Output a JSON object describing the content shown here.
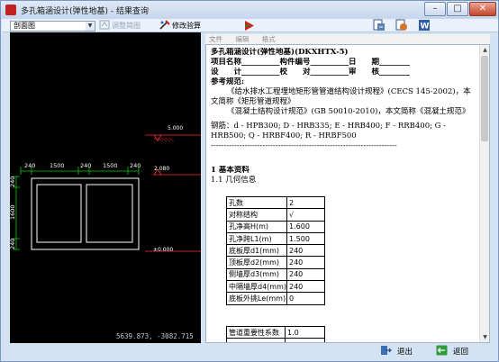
{
  "window": {
    "title": "多孔箱涵设计(弹性地基) - 结果查询",
    "minimize_label": "–",
    "maximize_label": "□",
    "close_label": "✕"
  },
  "toolbar": {
    "view_select_value": "剖面图",
    "adjust_label": "调整简图",
    "modify_label": "修改验算"
  },
  "drawing": {
    "dims_top": [
      "240",
      "1500",
      "240",
      "1500",
      "240"
    ],
    "dim_left_top": "240",
    "dim_left_middle": "1600",
    "dim_left_bottom": "240",
    "elevation_high": "5.000",
    "elevation_top": "2.080",
    "elevation_bottom": "±0.000",
    "coordinates": "5639.873, -3082.715"
  },
  "menu": {
    "items": [
      "文件",
      "编辑",
      "格式"
    ]
  },
  "document": {
    "title": "多孔箱涵设计(弹性地基)(DKXHTX-5)",
    "line_project": "项目名称__________构件编号__________日　　期________",
    "line_design": "设　　计__________校　　对__________审　　核________",
    "ref_heading": "参考规范:",
    "ref_1": "《给水排水工程埋地矩形管管道结构设计规程》(CECS 145-2002)，本文简称《矩形管道规程》",
    "ref_2": "《混凝土结构设计规范》(GB 50010-2010)，本文简称《混凝土规范》",
    "rebar": "钢筋：d - HPB300; D - HRB335; E - HRB400; F - RRB400; G - HRB500; Q - HRBF400; R - HRBF500",
    "separator": "------------------------------------------------------------------------",
    "section_1": "1  基本资料",
    "section_1_1": "1.1  几何信息",
    "params": [
      {
        "label": "孔数",
        "value": "2"
      },
      {
        "label": "对称结构",
        "value": "√"
      },
      {
        "label": "孔净高H(m)",
        "value": "1.600"
      },
      {
        "label": "孔净跨L1(m)",
        "value": "1.500"
      },
      {
        "label": "底板厚d1(mm)",
        "value": "240"
      },
      {
        "label": "顶板厚d2(mm)",
        "value": "240"
      },
      {
        "label": "侧墙厚d3(mm)",
        "value": "240"
      },
      {
        "label": "中隔墙厚d4(mm)",
        "value": "240"
      },
      {
        "label": "底板外挑Le(mm)",
        "value": "0"
      }
    ],
    "params2": [
      {
        "label": "管道重要性系数",
        "value": "1.0"
      }
    ]
  },
  "bottom": {
    "exit_label": "退出",
    "back_label": "返回"
  },
  "colors": {
    "window_bg": "#d4e3f4",
    "drawing_bg": "#000000",
    "structure_line": "#ffffff",
    "dimension_line": "#00cc00",
    "elevation_mark": "#ff3030"
  }
}
